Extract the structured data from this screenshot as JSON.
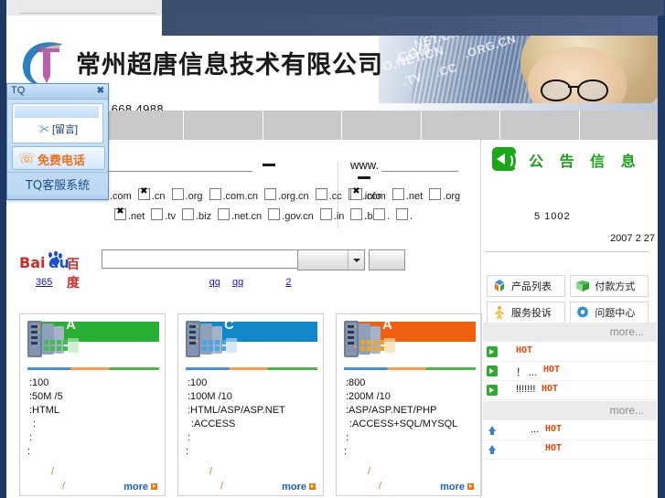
{
  "site": {
    "logo_text": "常州超唐信息技术有限公司",
    "hotline": "0 668 4988"
  },
  "banner": {
    "domain_words": [
      "FO.NET.CN",
      ".COM",
      ".TV",
      ".CC",
      ".NET.CN",
      ".ORG.CN",
      ".CN",
      ".GOV."
    ]
  },
  "nav": {
    "items": [
      "",
      "",
      "",
      "",
      "",
      "",
      ""
    ]
  },
  "tq": {
    "title": "TQ",
    "close": "✖",
    "message": "[留言]",
    "message_prefix": "✂",
    "free_call": "免费电话",
    "system": "TQ客服系统"
  },
  "domain_search": {
    "left": {
      "prefix": ".",
      "input_value": "",
      "dash": "",
      "row1": [
        {
          "label": ".com",
          "checked": true
        },
        {
          "label": ".cn",
          "checked": true
        },
        {
          "label": ".org",
          "checked": false
        },
        {
          "label": ".com.cn",
          "checked": false
        },
        {
          "label": ".org.cn",
          "checked": false
        },
        {
          "label": ".cc",
          "checked": false
        },
        {
          "label": ".info",
          "checked": false
        }
      ],
      "row2": [
        {
          "label": ".net",
          "checked": true
        },
        {
          "label": ".tv",
          "checked": false
        },
        {
          "label": ".biz",
          "checked": false
        },
        {
          "label": ".net.cn",
          "checked": false
        },
        {
          "label": ".gov.cn",
          "checked": false
        },
        {
          "label": ".in",
          "checked": false
        },
        {
          "label": ".biz",
          "checked": false
        }
      ]
    },
    "right": {
      "prefix": "www.",
      "input_value": "",
      "row1": [
        {
          "label": ".com",
          "checked": true
        },
        {
          "label": ".net",
          "checked": false
        },
        {
          "label": ".org",
          "checked": false
        }
      ],
      "row2": [
        {
          "label": ".",
          "checked": false
        },
        {
          "label": ".",
          "checked": false
        },
        {
          "label": ".",
          "checked": false
        }
      ]
    }
  },
  "baidu": {
    "logo_bai": "Bai",
    "logo_du": "du",
    "logo_zh": "百度",
    "input_value": "",
    "input_placeholder": "",
    "select_value": "",
    "button_label": ""
  },
  "quick_links": [
    "365",
    "",
    "",
    "",
    "",
    "qq",
    "qq",
    "",
    "2",
    "",
    ""
  ],
  "products": [
    {
      "server_letter": "A",
      "header_color": "#28b034",
      "specs": [
        ":100",
        ":50M  /5",
        ":HTML",
        " :",
        ":",
        ":"
      ],
      "price": "/",
      "price2": "/",
      "more_label": "more"
    },
    {
      "server_letter": "C",
      "header_color": "#1287c8",
      "specs": [
        ":100",
        ":100M  /10",
        ":HTML/ASP/ASP.NET",
        " :ACCESS",
        ":",
        ":"
      ],
      "price": "/",
      "price2": "/",
      "more_label": "more"
    },
    {
      "server_letter": "A",
      "header_color": "#f0600f",
      "specs": [
        ":800",
        ":200M  /10",
        ":ASP/ASP.NET/PHP",
        " :ACCESS+SQL/MYSQL",
        ":",
        ":"
      ],
      "price": "/",
      "price2": "/",
      "more_label": "more"
    }
  ],
  "sidebar": {
    "notice_title": "公 告 信 息",
    "notice_line": "5    1002",
    "notice_date": "2007 2 27",
    "quick_buttons": [
      {
        "label": "产品列表",
        "icon": "cubes-icon"
      },
      {
        "label": "付款方式",
        "icon": "book-icon"
      },
      {
        "label": "服务投诉",
        "icon": "person-icon"
      },
      {
        "label": "问题中心",
        "icon": "gear-icon"
      }
    ],
    "more_label": "more...",
    "news": [
      {
        "icon": "green-arrow",
        "text": "",
        "hot": "HOT"
      },
      {
        "icon": "green-arrow",
        "text": "！   ...",
        "hot": "HOT"
      },
      {
        "icon": "green-arrow",
        "text": "!!!!!!!",
        "hot": "HOT"
      }
    ],
    "news2": [
      {
        "icon": "blue-up-arrow",
        "text": "...",
        "hot": "HOT"
      },
      {
        "icon": "blue-up-arrow",
        "text": "",
        "hot": "HOT"
      }
    ]
  },
  "colors": {
    "edge_blue": "#1f3864",
    "nav_gray": "#c9c9c9",
    "notice_green": "#18a018",
    "hot_orange": "#ee4400",
    "link_blue": "#1414d0"
  }
}
